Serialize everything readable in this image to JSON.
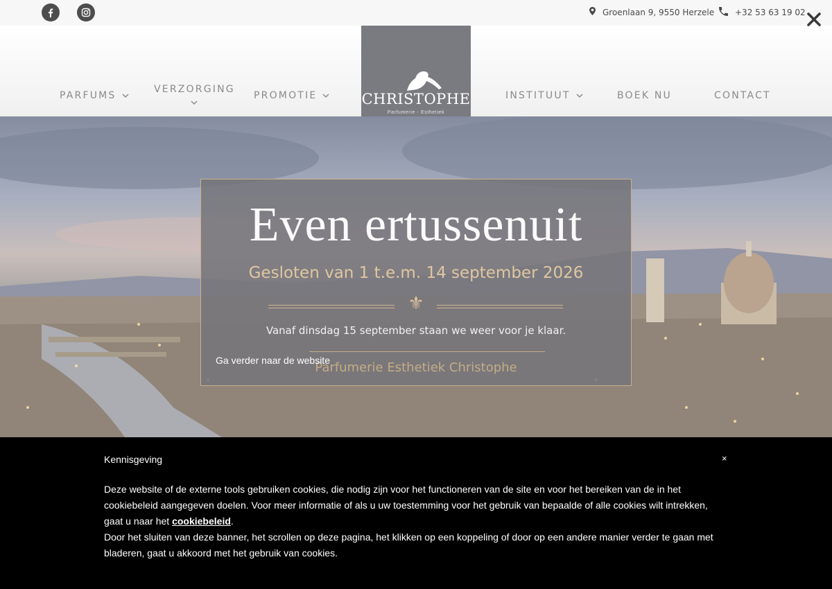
{
  "topbar": {
    "social": [
      {
        "icon": "facebook-icon"
      },
      {
        "icon": "instagram-icon"
      }
    ],
    "address": "Groenlaan 9, 9550 Herzele",
    "phone": "+32 53 63 19 02"
  },
  "nav": {
    "left": [
      {
        "label": "PARFUMS",
        "dropdown": true
      },
      {
        "label": "VERZORGING",
        "dropdown": true
      },
      {
        "label": "PROMOTIE",
        "dropdown": true
      }
    ],
    "right": [
      {
        "label": "INSTITUUT",
        "dropdown": true
      },
      {
        "label": "BOEK NU",
        "dropdown": false
      },
      {
        "label": "CONTACT",
        "dropdown": false
      }
    ]
  },
  "logo": {
    "name": "CHRISTOPHE",
    "subtitle": "Parfumerie - Esthetiek"
  },
  "modal": {
    "heading": "Even ertussenuit",
    "subheading": "Gesloten van 1 t.e.m. 14 september 2026",
    "info": "Vanaf dinsdag 15 september staan we weer voor je klaar.",
    "link": "Ga verder naar de website",
    "signature": "Parfumerie Esthetiek Christophe"
  },
  "cookie": {
    "title": "Kennisgeving",
    "close": "×",
    "text1_before": "Deze website of de externe tools gebruiken cookies, die nodig zijn voor het functioneren van de site en voor het bereiken van de in het cookiebeleid aangegeven doelen. Voor meer informatie of als u uw toestemming voor het gebruik van bepaalde of alle cookies wilt intrekken, gaat u naar het ",
    "link": "cookiebeleid",
    "text1_after": ".",
    "text2": "Door het sluiten van deze banner, het scrollen op deze pagina, het klikken op een koppeling of door op een andere manier verder te gaan met bladeren, gaat u akkoord met het gebruik van cookies."
  },
  "colors": {
    "logo_bg": "#7a7b80",
    "accent_gold": "#d2b78e",
    "nav_text": "#8a8a8a",
    "cookie_bg": "#000000"
  }
}
